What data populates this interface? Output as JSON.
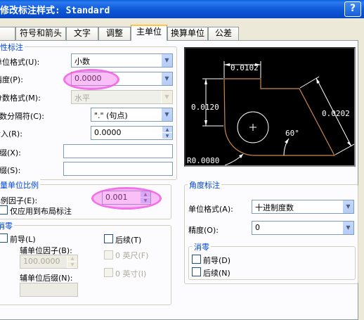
{
  "window": {
    "title": "修改标注样式: Standard",
    "help": "?"
  },
  "tabs": [
    "符号和箭头",
    "文字",
    "调整",
    "主单位",
    "换算单位",
    "公差"
  ],
  "active_tab": "主单位",
  "linear": {
    "group_title": "线性标注",
    "unit_format_label": "单位格式(U):",
    "unit_format_value": "小数",
    "precision_label": "精度(P):",
    "precision_value": "0.0000",
    "fraction_format_label": "分数格式(M):",
    "fraction_format_value": "水平",
    "decimal_sep_label": "小数分隔符(C):",
    "decimal_sep_value": "\".\" (句点)",
    "round_off_label": "舍入(R):",
    "round_off_value": "0.0000",
    "prefix_label": "前缀(X):",
    "prefix_value": "",
    "suffix_label": "后缀(S):",
    "suffix_value": ""
  },
  "measurement_scale": {
    "group_title": "测量单位比例",
    "scale_factor_label": "比例因子(E):",
    "scale_factor_value": "0.001",
    "layout_only_label": "仅应用到布局标注"
  },
  "zero_suppression": {
    "group_title": "消零",
    "leading_label": "前导(L)",
    "trailing_label": "后续(T)",
    "sub_factor_label": "辅单位因子(B):",
    "sub_factor_value": "100.0000",
    "zero_feet_label": "0 英尺(F)",
    "zero_inches_label": "0 英寸(I)",
    "sub_suffix_label": "辅单位后缀(N):",
    "sub_suffix_value": ""
  },
  "angular": {
    "group_title": "角度标注",
    "unit_format_label": "单位格式(A):",
    "unit_format_value": "十进制度数",
    "precision_label": "精度(O):",
    "precision_value": "0",
    "zero_title": "消零",
    "leading_label": "前导(D)",
    "trailing_label": "后续(N)"
  },
  "preview": {
    "dim_top": "0.0102",
    "dim_left": "0.0120",
    "dim_right": "0.0202",
    "angle": "60°",
    "radius": "R0.0080"
  },
  "colors": {
    "title_bar": "#0a5fd8",
    "group_title": "#0046d5",
    "preview_bg": "#000000",
    "preview_shape": "#c98a4b",
    "highlight": "#f266e9"
  }
}
